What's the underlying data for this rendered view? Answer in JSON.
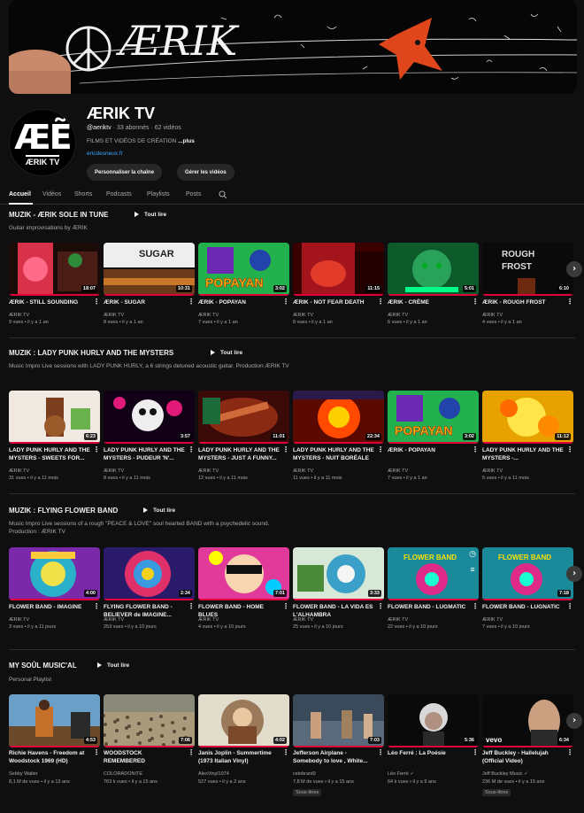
{
  "banner": {
    "text": "ÆRIK"
  },
  "channel": {
    "avatar_text": "ÆẼ",
    "avatar_sub": "ÆRIK TV",
    "name": "ÆRIK TV",
    "handle": "@aeriktv",
    "stats": "· 33 abonnés · 62 vidéos",
    "description": "FILMS ET VIDÉOS DE CRÉATION",
    "more": "...plus",
    "link": "ericdesneux.fr",
    "btn_customize": "Personnaliser la chaîne",
    "btn_manage": "Gérer les vidéos"
  },
  "tabs": [
    "Accueil",
    "Vidéos",
    "Shorts",
    "Podcasts",
    "Playlists",
    "Posts"
  ],
  "sections": [
    {
      "title": "MUZIK - ÆRIK SOLE IN TUNE",
      "play_all": "Tout lire",
      "description": "Guitar improvisations by ÆRIK",
      "videos": [
        {
          "title": "ÆRIK - STILL SOUNDING",
          "channel": "ÆRIK TV",
          "meta": "9 vues • il y a 1 an",
          "duration": "18:07"
        },
        {
          "title": "ÆRIK - SUGAR",
          "channel": "ÆRIK TV",
          "meta": "8 vues • il y a 1 an",
          "duration": "10:31"
        },
        {
          "title": "ÆRIK - POPAYAN",
          "channel": "ÆRIK TV",
          "meta": "7 vues • il y a 1 an",
          "duration": "3:02"
        },
        {
          "title": "ÆRIK - NOT FEAR DEATH",
          "channel": "ÆRIK TV",
          "meta": "8 vues • il y a 1 an",
          "duration": "11:15"
        },
        {
          "title": "ÆRIK - CRÈME",
          "channel": "ÆRIK TV",
          "meta": "6 vues • il y a 1 an",
          "duration": "5:01"
        },
        {
          "title": "ÆRIK - ROUGH FROST",
          "channel": "ÆRIK TV",
          "meta": "4 vues • il y a 1 an",
          "duration": "6:10"
        }
      ]
    },
    {
      "title": "MUZIK : LADY PUNK HURLY AND THE MYSTERS",
      "play_all": "Tout lire",
      "description": "Music Impro Live sessions with LADY PUNK HURLY, a 6 strings detuned acoustic guitar. Production ÆRIK TV",
      "videos": [
        {
          "title": "LADY PUNK HURLY AND THE MYSTERS - SWEETS FOR...",
          "channel": "ÆRIK TV",
          "meta": "31 vues • il y a 11 mois",
          "duration": "6:23"
        },
        {
          "title": "LADY PUNK HURLY AND THE MYSTERS - PUDEUR 'N'...",
          "channel": "ÆRIK TV",
          "meta": "8 vues • il y a 11 mois",
          "duration": "3:57"
        },
        {
          "title": "LADY PUNK HURLY AND THE MYSTERS - JUST A FUNNY...",
          "channel": "ÆRIK TV",
          "meta": "12 vues • il y a 11 mois",
          "duration": "11:01"
        },
        {
          "title": "LADY PUNK HURLY AND THE MYSTERS - NUIT BORÉALE",
          "channel": "ÆRIK TV",
          "meta": "11 vues • il y a 11 mois",
          "duration": "22:34"
        },
        {
          "title": "ÆRIK - POPAYAN",
          "channel": "ÆRIK TV",
          "meta": "7 vues • il y a 1 an",
          "duration": "3:02"
        },
        {
          "title": "LADY PUNK HURLY AND THE MYSTERS -...",
          "channel": "ÆRIK TV",
          "meta": "5 vues • il y a 11 mois",
          "duration": "11:12"
        }
      ]
    },
    {
      "title": "MUZIK : FLYING FLOWER BAND",
      "play_all": "Tout lire",
      "description": "Music Impro Live sessions of a rough \"PEACE & LOVE\" soul hearted BAND with a psychedelic sound. Production : ÆRIK TV",
      "videos": [
        {
          "title": "FLOWER BAND - IMAGINE",
          "channel": "ÆRIK TV",
          "meta": "3 vues • il y a 11 jours",
          "duration": "4:00"
        },
        {
          "title": "FLYING FLOWER BAND - BELIEVER de IMAGINE...",
          "channel": "ÆRIK TV",
          "meta": "253 vues • il y a 10 jours",
          "duration": "2:34"
        },
        {
          "title": "FLOWER BAND - HOME BLUES",
          "channel": "ÆRIK TV",
          "meta": "4 vues • il y a 10 jours",
          "duration": "7:01"
        },
        {
          "title": "FLOWER BAND - LA VIDA ES L'ALHAMBRA",
          "channel": "ÆRIK TV",
          "meta": "25 vues • il y a 10 jours",
          "duration": "3:33"
        },
        {
          "title": "FLOWER BAND - LUGMATIC",
          "channel": "ÆRIK TV",
          "meta": "22 vues • il y a 10 jours",
          "duration": ""
        },
        {
          "title": "FLOWER BAND - LUGNATIC",
          "channel": "ÆRIK TV",
          "meta": "7 vues • il y a 10 jours",
          "duration": "7:18"
        }
      ]
    },
    {
      "title": "MY SOÛL MUSIC'AL",
      "play_all": "Tout lire",
      "description": "Personal Playlist",
      "videos": [
        {
          "title": "Richie Havens - Freedom at Woodstock 1969 (HD)",
          "channel": "Sebby Walter",
          "meta": "8,1 M de vues • il y a 13 ans",
          "duration": "4:53",
          "badge": ""
        },
        {
          "title": "WOODSTOCK REMEMBERED",
          "channel": "COLORADONITE",
          "meta": "763 k vues • il y a 15 ans",
          "duration": "7:06",
          "badge": ""
        },
        {
          "title": "Janis Joplin - Summertime (1973 Italian Vinyl)",
          "channel": "AlexVinyl1974",
          "meta": "527 vues • il y a 2 ans",
          "duration": "4:02",
          "badge": ""
        },
        {
          "title": "Jefferson Airplane - Somebody to love , White...",
          "channel": "celebrant9",
          "meta": "7,8 M de vues • il y a 15 ans",
          "duration": "7:03",
          "badge": "Sous-titres"
        },
        {
          "title": "Léo Ferré : La Poésie",
          "channel": "Léo Ferré ✓",
          "meta": "64 k vues • il y a 9 ans",
          "duration": "5:36",
          "badge": ""
        },
        {
          "title": "Jeff Buckley - Hallelujah (Official Video)",
          "channel": "Jeff Buckley Music ✓",
          "meta": "236 M de vues • il y a 15 ans",
          "duration": "6:34",
          "badge": "Sous-titres"
        }
      ]
    }
  ],
  "thumb_labels": {
    "sugar": "SUGAR",
    "popayan": "POPAYAN",
    "flower_band": "FLOWER BAND",
    "rough_frost": "ROUGH FROST",
    "vevo": "vevo"
  },
  "icons": {
    "next": "chevron-right-icon",
    "search": "search-icon",
    "kebab": "more-vert-icon",
    "play": "play-icon"
  }
}
